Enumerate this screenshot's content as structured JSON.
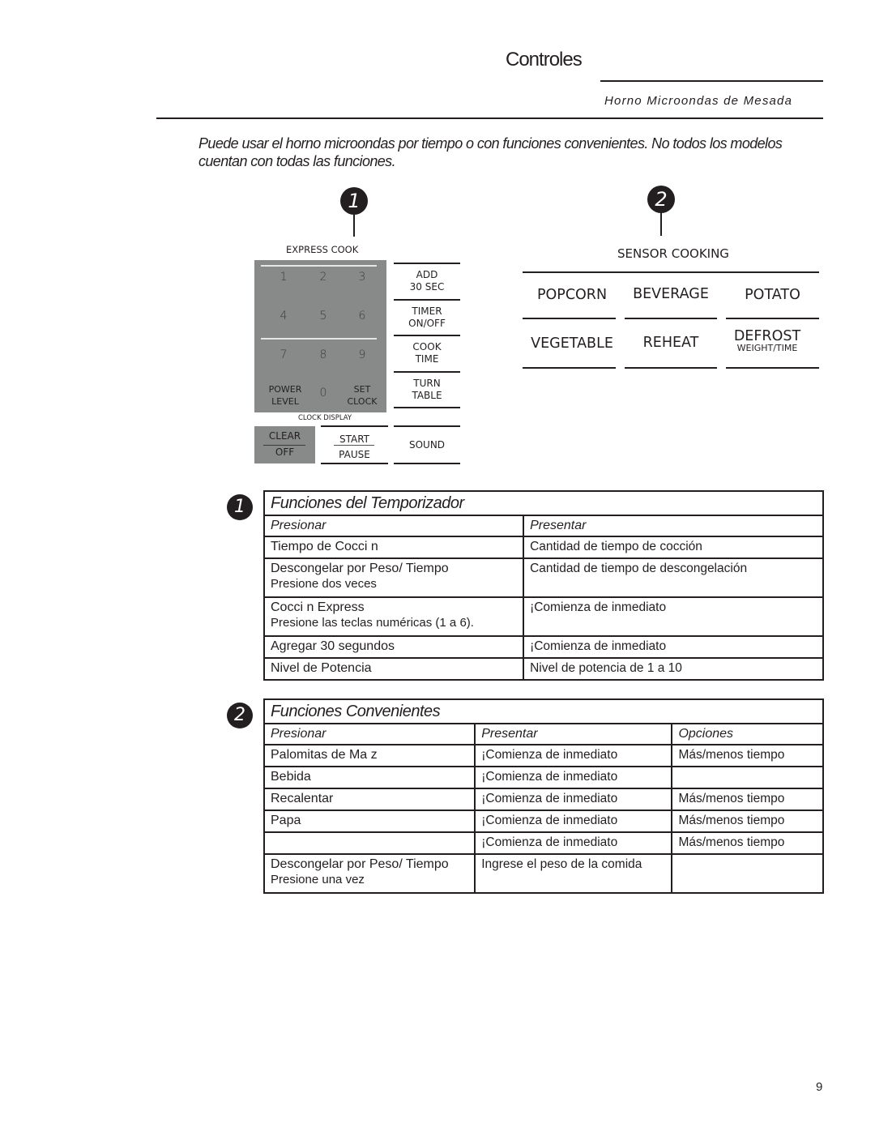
{
  "header": {
    "title": "Controles",
    "subtitle": "Horno Microondas de Mesada"
  },
  "intro": "Puede usar el horno microondas por tiempo o con funciones convenientes. No todos los modelos cuentan con todas las funciones.",
  "callouts": {
    "one": "1",
    "two": "2"
  },
  "keypad": {
    "express_label": "EXPRESS COOK",
    "numbers": [
      "1",
      "2",
      "3",
      "4",
      "5",
      "6",
      "7",
      "8",
      "9",
      "0"
    ],
    "power_level": [
      "POWER",
      "LEVEL"
    ],
    "set_clock": [
      "SET",
      "CLOCK"
    ],
    "clock_display": "CLOCK DISPLAY",
    "side_buttons": [
      {
        "line1": "ADD",
        "line2": "30 SEC"
      },
      {
        "line1": "TIMER",
        "line2": "ON/OFF"
      },
      {
        "line1": "COOK",
        "line2": "TIME"
      },
      {
        "line1": "TURN",
        "line2": "TABLE"
      }
    ],
    "clear_off": [
      "CLEAR",
      "OFF"
    ],
    "start_pause": [
      "START",
      "PAUSE"
    ],
    "sound": "SOUND"
  },
  "sensor": {
    "label": "SENSOR COOKING",
    "buttons": [
      {
        "label": "POPCORN"
      },
      {
        "label": "BEVERAGE"
      },
      {
        "label": "POTATO"
      },
      {
        "label": "VEGETABLE"
      },
      {
        "label": "REHEAT"
      },
      {
        "label": "DEFROST",
        "sub": "WEIGHT/TIME"
      }
    ]
  },
  "timer_table": {
    "badge": "1",
    "caption": "Funciones del Temporizador",
    "headers": [
      "Presionar",
      "Presentar"
    ],
    "rows": [
      {
        "press": "Tiempo de Cocci n",
        "press_sub": "",
        "display": "Cantidad de tiempo de cocción"
      },
      {
        "press": "Descongelar por Peso/ Tiempo",
        "press_sub": "Presione dos veces",
        "display": "Cantidad de tiempo de descongelación"
      },
      {
        "press": "Cocci n Express",
        "press_sub": "Presione las teclas numéricas (1 a 6).",
        "display": "¡Comienza de inmediato"
      },
      {
        "press": "Agregar 30 segundos",
        "press_sub": "",
        "display": "¡Comienza de inmediato"
      },
      {
        "press": "Nivel de Potencia",
        "press_sub": "",
        "display": "Nivel de potencia de 1 a 10"
      }
    ]
  },
  "convenience_table": {
    "badge": "2",
    "caption": "Funciones Convenientes",
    "headers": [
      "Presionar",
      "Presentar",
      "Opciones"
    ],
    "rows": [
      {
        "press": "Palomitas de Ma z",
        "press_sub": "",
        "display": "¡Comienza de inmediato",
        "options": "Más/menos tiempo"
      },
      {
        "press": "Bebida",
        "press_sub": "",
        "display": "¡Comienza de inmediato",
        "options": ""
      },
      {
        "press": "Recalentar",
        "press_sub": "",
        "display": "¡Comienza de inmediato",
        "options": "Más/menos tiempo"
      },
      {
        "press": "Papa",
        "press_sub": "",
        "display": "¡Comienza de inmediato",
        "options": "Más/menos tiempo"
      },
      {
        "press": "",
        "press_sub": "",
        "display": "¡Comienza de inmediato",
        "options": "Más/menos tiempo"
      },
      {
        "press": "Descongelar por Peso/ Tiempo",
        "press_sub": "Presione una vez",
        "display": "Ingrese el peso de la comida",
        "options": ""
      }
    ]
  },
  "page_number": "9"
}
